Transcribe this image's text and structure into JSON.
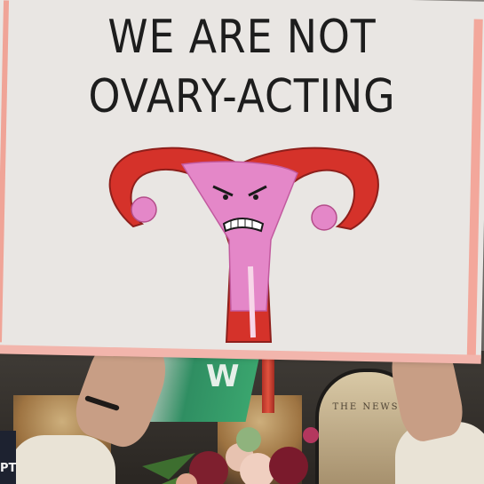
{
  "sign": {
    "line1": "WE ARE NOT",
    "line2": "OVARY-ACTING"
  },
  "background": {
    "store_sign": "THE NEWS",
    "flag_letter": "W",
    "bag_text": "PT"
  },
  "colors": {
    "sign_board": "#e9e6e3",
    "sign_edge": "#f3a79b",
    "uterus_outline": "#d5322a",
    "uterus_fill": "#e487c8",
    "text": "#1d1d1d"
  },
  "icons": [
    "angry-uterus-icon"
  ]
}
